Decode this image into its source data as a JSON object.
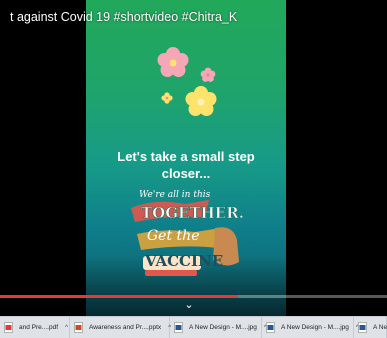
{
  "video": {
    "title": "t against Covid 19 #shortvideo #Chitra_K",
    "caption_line1": "Let's take a small step",
    "caption_line2": "closer...",
    "art_lines": [
      "We're all in this",
      "TOGETHER.",
      "Get the",
      "VACCINE"
    ],
    "progress": 0.615,
    "controls_icon": "chevron-down-icon"
  },
  "colors": {
    "video_gradient_top": "#22a85a",
    "video_gradient_bottom": "#0d5a68",
    "progress_fill": "#e53935",
    "downloads_bar": "#dfe3e8"
  },
  "downloads": [
    {
      "name": "and Pre....pdf",
      "icon": "pdf-file-icon",
      "color": "#e53935"
    },
    {
      "name": "Awareness and Pr....pptx",
      "icon": "pptx-file-icon",
      "color": "#d24726"
    },
    {
      "name": "A New Design - M....jpg",
      "icon": "jpg-file-icon",
      "color": "#2b579a"
    },
    {
      "name": "A New Design - M....jpg",
      "icon": "jpg-file-icon",
      "color": "#2b579a"
    },
    {
      "name": "A New",
      "icon": "jpg-file-icon",
      "color": "#2b579a"
    }
  ],
  "download_caret": "^"
}
